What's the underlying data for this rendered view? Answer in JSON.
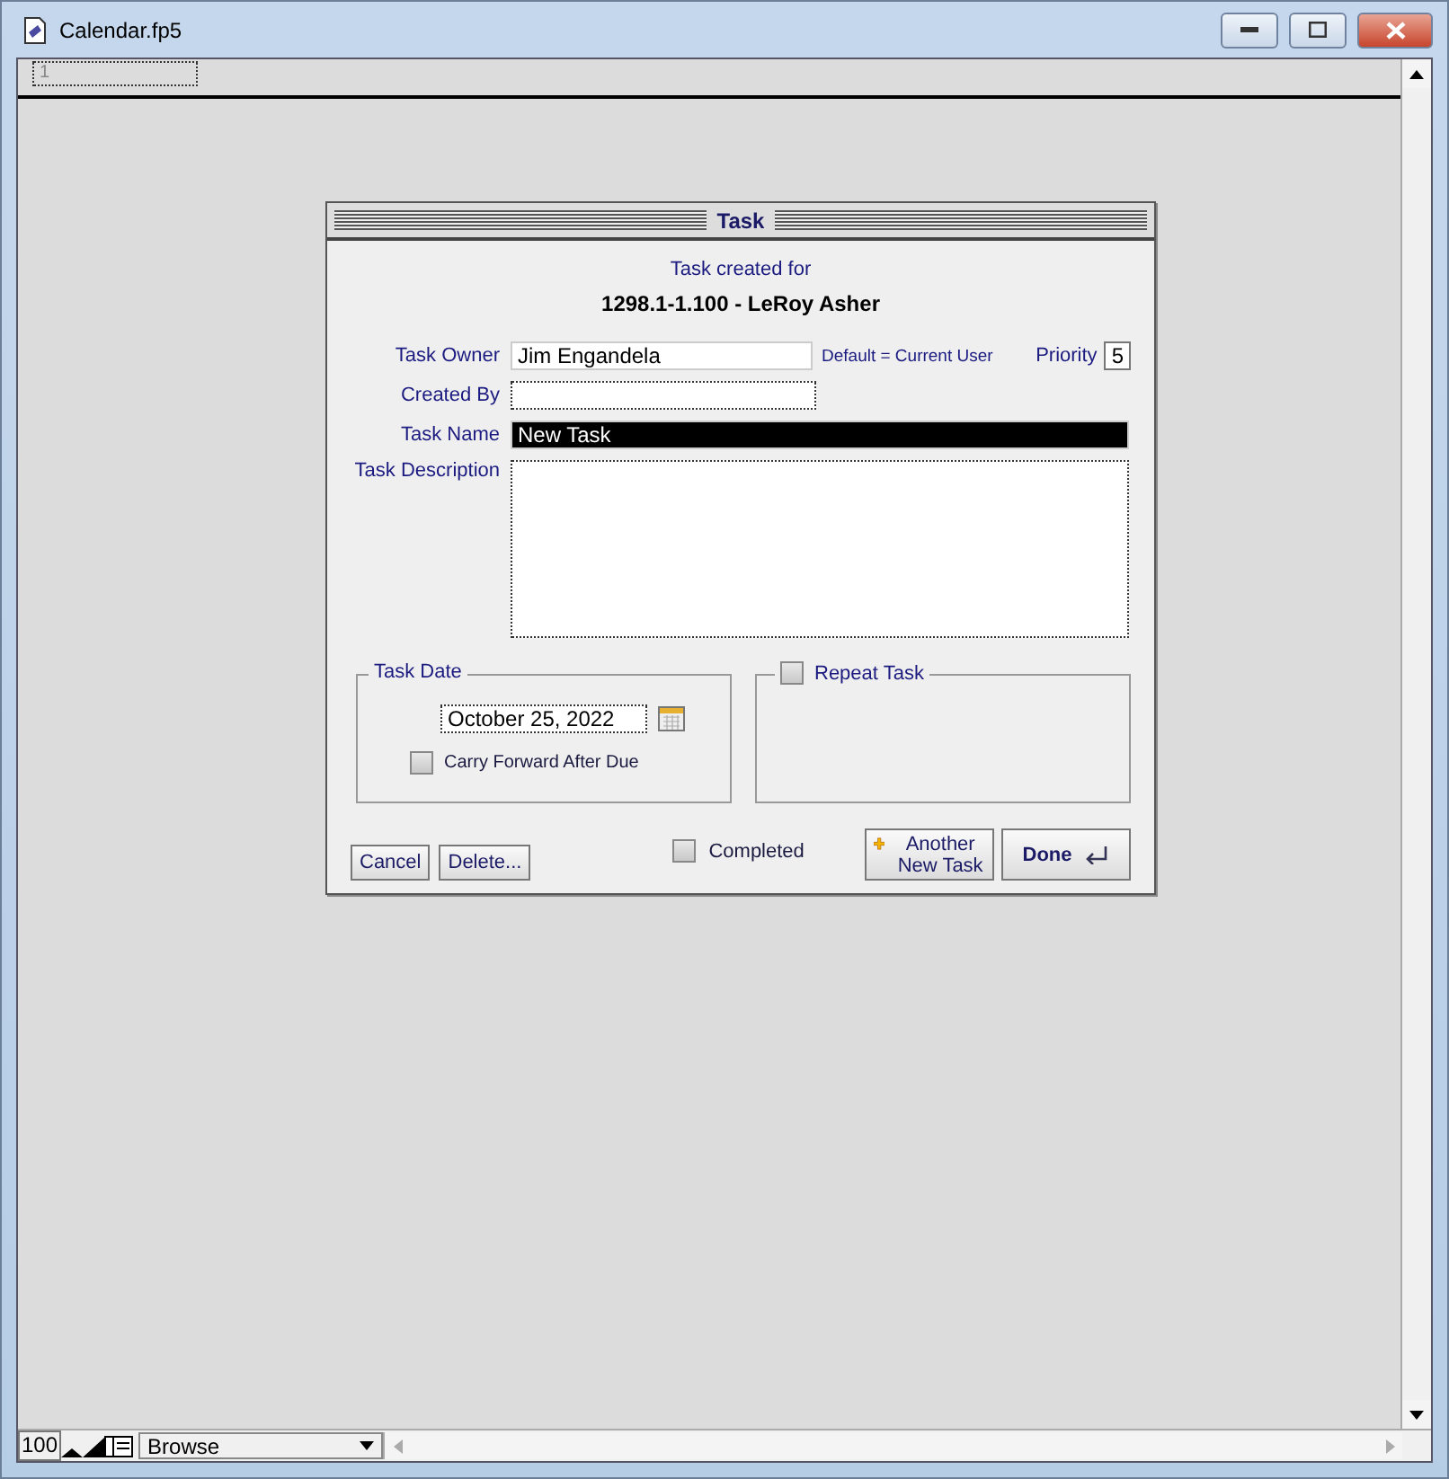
{
  "window": {
    "title": "Calendar.fp5"
  },
  "record_field": {
    "value": "1"
  },
  "dialog": {
    "title": "Task",
    "heading": "Task created for",
    "record": "1298.1-1.100 - LeRoy Asher",
    "task_owner": {
      "label": "Task Owner",
      "value": "Jim Engandela",
      "note": "Default = Current User"
    },
    "priority": {
      "label": "Priority",
      "value": "5"
    },
    "created_by": {
      "label": "Created By"
    },
    "task_name": {
      "label": "Task Name",
      "value": "New Task"
    },
    "task_description": {
      "label": "Task Description"
    },
    "task_date": {
      "legend": "Task Date",
      "value": "October 25, 2022",
      "carry_forward": {
        "label": "Carry Forward After Due",
        "checked": false
      }
    },
    "repeat_task": {
      "label": "Repeat Task",
      "checked": false
    },
    "completed": {
      "label": "Completed",
      "checked": false
    },
    "buttons": [
      {
        "label": "Cancel",
        "kind": "plain"
      },
      {
        "label": "Delete...",
        "kind": "plain"
      },
      {
        "label": "Another New Task",
        "kind": "add"
      },
      {
        "label": "Done",
        "kind": "done"
      }
    ]
  },
  "status_bar": {
    "zoom": "100",
    "mode": "Browse"
  }
}
